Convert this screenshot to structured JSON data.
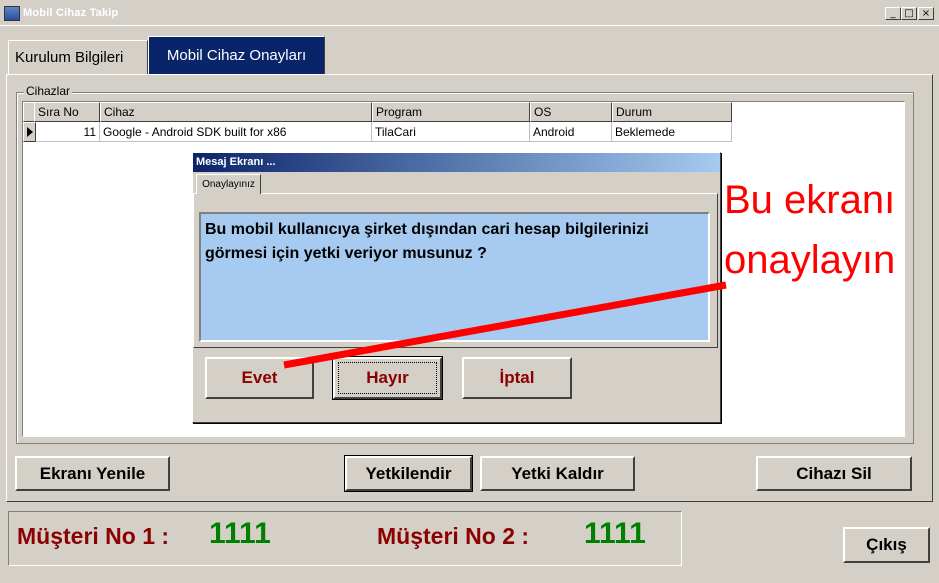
{
  "window": {
    "title": "Mobil Cihaz Takip",
    "controls": {
      "minimize": "_",
      "maximize": "□",
      "close": "×"
    }
  },
  "tabs": [
    {
      "label": "Kurulum Bilgileri",
      "active": false
    },
    {
      "label": "Mobil Cihaz Onayları",
      "active": true
    }
  ],
  "devices_group": {
    "label": "Cihazlar",
    "columns": [
      "Sıra No",
      "Cihaz",
      "Program",
      "OS",
      "Durum"
    ],
    "rows": [
      {
        "sira_no": "11",
        "cihaz": "Google - Android SDK built for x86",
        "program": "TilaCari",
        "os": "Android",
        "durum": "Beklemede"
      }
    ]
  },
  "dialog": {
    "title": "Mesaj Ekranı ...",
    "tab": "Onaylayınız",
    "message": "Bu mobil kullanıcıya şirket dışından cari hesap bilgilerinizi görmesi için yetki veriyor musunuz ?",
    "buttons": {
      "yes": "Evet",
      "no": "Hayır",
      "cancel": "İptal"
    }
  },
  "annotation": {
    "line1": "Bu ekranı",
    "line2": "onaylayın",
    "color": "#ff0000"
  },
  "actions": {
    "refresh": "Ekranı Yenile",
    "authorize": "Yetkilendir",
    "revoke": "Yetki Kaldır",
    "delete_device": "Cihazı Sil",
    "exit": "Çıkış"
  },
  "status": {
    "customer1_label": "Müşteri No  1 :",
    "customer1_value": "1111",
    "customer2_label": "Müşteri No  2 :",
    "customer2_value": "1111"
  },
  "colors": {
    "accent": "#0a246a",
    "message_bg": "#a6caf0",
    "label_red": "#8b0000",
    "value_green": "#008000"
  }
}
